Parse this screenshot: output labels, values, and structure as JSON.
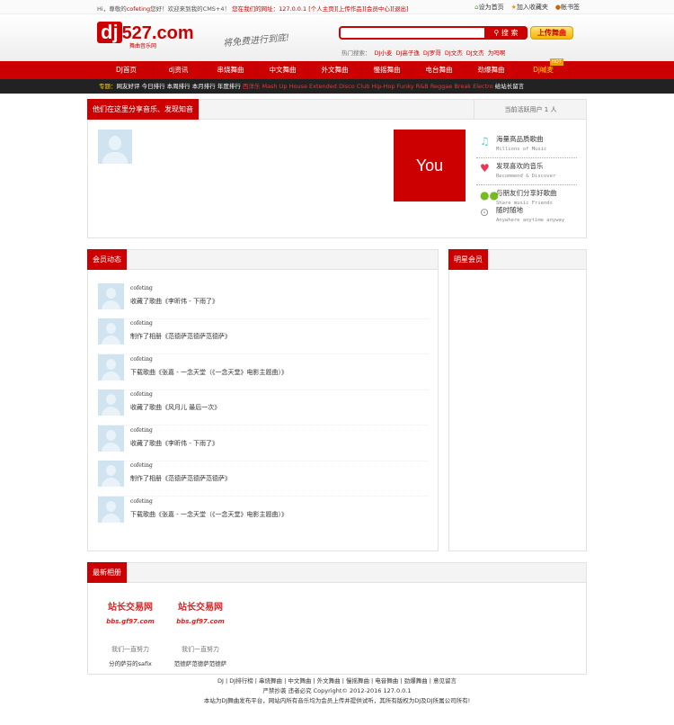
{
  "topbar": {
    "greeting": "Hi，尊敬的",
    "user": "cofeting",
    "greeting2": "您好！欢迎来到我的CMS+4！",
    "ip_label": "您在我们的网址：127.0.0.1",
    "links": [
      "[个人主页]",
      "[上传作品]",
      "[会员中心]",
      "[退出]"
    ],
    "right": [
      "设为首页",
      "加入收藏夹",
      "帐书签"
    ]
  },
  "header": {
    "logo_main": "dj",
    "logo_num": "527.com",
    "logo_sub": "舞曲音乐网",
    "slogan": "将免费进行到底!",
    "search_placeholder": "",
    "search_button": "搜 索",
    "upload_button": "上传舞曲",
    "hot_label": "热门搜索：",
    "hot_terms": [
      "DJ小麦",
      "DJ高子逸",
      "DJ罗哥",
      "DJ文杰",
      "DJ文杰",
      "为吗啊"
    ]
  },
  "nav": {
    "items": [
      "DJ首页",
      "dj资讯",
      "串烧舞曲",
      "中文舞曲",
      "外文舞曲",
      "慢摇舞曲",
      "电台舞曲",
      "劲爆舞曲",
      "Dj喊麦"
    ],
    "hot_badge": "HOT"
  },
  "subnav": {
    "label": "专题：",
    "items": [
      "网友好评",
      "今日排行",
      "本周排行",
      "本月排行",
      "年度排行"
    ],
    "genres": "西洋乐 Mash Up House Extended Disco Club Hip-Hop Funky R&B Reggae Break Electro",
    "last": "给站长留言"
  },
  "share_box": {
    "title": "他们在这里分享音乐、发现知音",
    "active_users": "当前活跃用户 1 人",
    "you": "You",
    "features": [
      {
        "icon": "music-note-icon",
        "title": "海量高品质歌曲",
        "sub": "Millions of Music"
      },
      {
        "icon": "heart-icon",
        "title": "发现喜欢的音乐",
        "sub": "Recommend & Discover"
      },
      {
        "icon": "friends-icon",
        "title": "与朋友们分享好歌曲",
        "sub": "Share music Friends"
      },
      {
        "icon": "location-pin-icon",
        "title": "随时随地",
        "sub": "Anywhere anytime anyway"
      }
    ]
  },
  "activity": {
    "title": "会员动态",
    "items": [
      {
        "user": "cofeting",
        "msg": "收藏了歌曲《李昕伟 - 下雨了》"
      },
      {
        "user": "cofeting",
        "msg": "制作了相册《范德萨范德萨范德萨》"
      },
      {
        "user": "cofeting",
        "msg": "下载歌曲《张嘉 - 一念天堂（《一念天堂》电影主题曲）》"
      },
      {
        "user": "cofeting",
        "msg": "收藏了歌曲《风月儿 最后一次》"
      },
      {
        "user": "cofeting",
        "msg": "收藏了歌曲《李昕伟 - 下雨了》"
      },
      {
        "user": "cofeting",
        "msg": "制作了相册《范德萨范德萨范德萨》"
      },
      {
        "user": "cofeting",
        "msg": "下载歌曲《张嘉 - 一念天堂（《一念天堂》电影主题曲）》"
      }
    ]
  },
  "star_members": {
    "title": "明星会员"
  },
  "albums": {
    "title": "最新相册",
    "items": [
      {
        "l1": "站长交易网",
        "l2": "bbs.gf97.com",
        "l3": "我们一直努力",
        "name": "分的萨芬的safix"
      },
      {
        "l1": "站长交易网",
        "l2": "bbs.gf97.com",
        "l3": "我们一直努力",
        "name": "范德萨范德萨范德萨"
      }
    ]
  },
  "footer": {
    "links": "DJ | DJ排行榜 | 串烧舞曲 | 中文舞曲 | 外文舞曲 | 慢摇舞曲 | 电音舞曲 | 劲爆舞曲 | 意见留言",
    "copyright": "严禁抄袭 违者必究 Copyright© 2012-2016 127.0.0.1",
    "notice": "本站为DJ舞曲发布平台，网站内所有音乐均为会员上传并提供试听，其所有版权为DJ及DJ所属公司所有!"
  }
}
